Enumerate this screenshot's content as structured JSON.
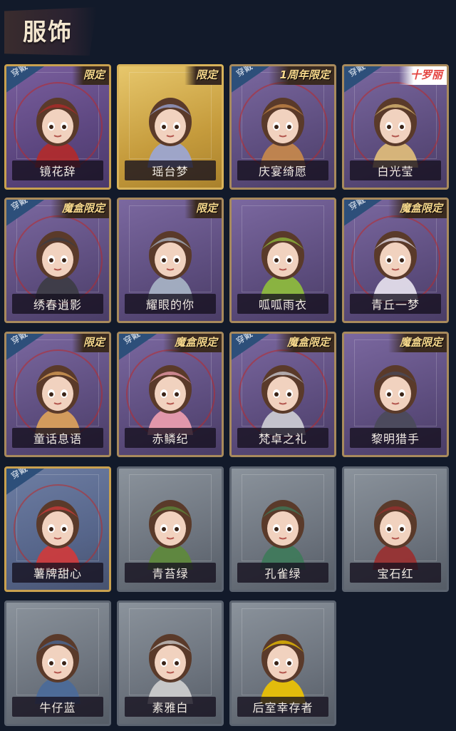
{
  "header": {
    "title": "服饰"
  },
  "worn_label": "穿戴",
  "items": [
    {
      "name": "镜花辞",
      "tag": "限定",
      "worn": true,
      "style": "gold",
      "color": "#b22a2a"
    },
    {
      "name": "瑶台梦",
      "tag": "限定",
      "worn": false,
      "style": "full-gold",
      "color": "#9aa6d8"
    },
    {
      "name": "庆宴绮愿",
      "tag": "1周年限定",
      "worn": true,
      "style": "purple",
      "color": "#c98a4a"
    },
    {
      "name": "白光莹",
      "tag": "十罗丽",
      "worn": true,
      "style": "purple",
      "color": "#e3c07a"
    },
    {
      "name": "绣春逍影",
      "tag": "魔盒限定",
      "worn": true,
      "style": "purple",
      "color": "#3c3c44"
    },
    {
      "name": "耀眼的你",
      "tag": "限定",
      "worn": false,
      "style": "purple",
      "color": "#a9b6c6"
    },
    {
      "name": "呱呱雨衣",
      "tag": "",
      "worn": false,
      "style": "purple",
      "color": "#8fbf3b"
    },
    {
      "name": "青丘一梦",
      "tag": "魔盒限定",
      "worn": true,
      "style": "purple",
      "color": "#e9e4ef"
    },
    {
      "name": "童话息语",
      "tag": "限定",
      "worn": true,
      "style": "purple",
      "color": "#e0a45a"
    },
    {
      "name": "赤鳞纪",
      "tag": "魔盒限定",
      "worn": true,
      "style": "purple",
      "color": "#f0a0b0"
    },
    {
      "name": "梵卓之礼",
      "tag": "魔盒限定",
      "worn": true,
      "style": "purple",
      "color": "#cfcfd6"
    },
    {
      "name": "黎明猎手",
      "tag": "魔盒限定",
      "worn": false,
      "style": "purple",
      "color": "#4a4a5a"
    },
    {
      "name": "薯牌甜心",
      "tag": "",
      "worn": true,
      "style": "blue",
      "color": "#d23a3a"
    },
    {
      "name": "青苔绿",
      "tag": "",
      "worn": false,
      "style": "grey",
      "color": "#5e8a3a"
    },
    {
      "name": "孔雀绿",
      "tag": "",
      "worn": false,
      "style": "grey",
      "color": "#3e7a5a"
    },
    {
      "name": "宝石红",
      "tag": "",
      "worn": false,
      "style": "grey",
      "color": "#9a2f2f"
    },
    {
      "name": "牛仔蓝",
      "tag": "",
      "worn": false,
      "style": "grey",
      "color": "#4a6a9a"
    },
    {
      "name": "素雅白",
      "tag": "",
      "worn": false,
      "style": "grey",
      "color": "#d0d0d0"
    },
    {
      "name": "后室幸存者",
      "tag": "",
      "worn": false,
      "style": "grey",
      "color": "#f0c400"
    }
  ]
}
